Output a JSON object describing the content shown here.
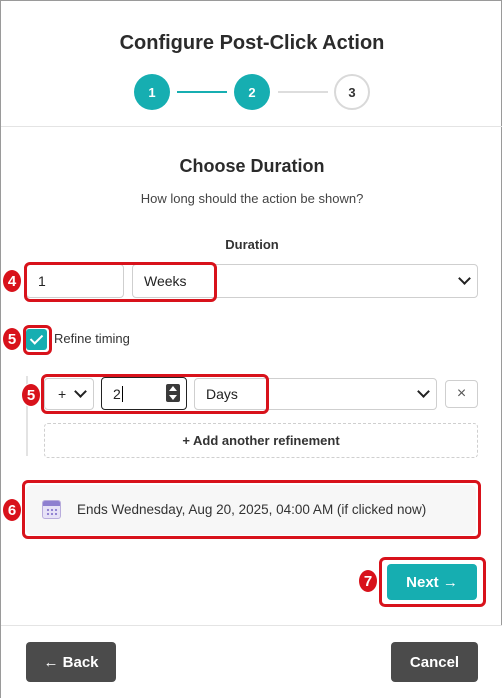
{
  "dialog": {
    "title": "Configure Post-Click Action",
    "steps": [
      {
        "label": "1",
        "state": "active"
      },
      {
        "label": "2",
        "state": "active"
      },
      {
        "label": "3",
        "state": "pending"
      }
    ]
  },
  "section": {
    "title": "Choose Duration",
    "subtitle": "How long should the action be shown?"
  },
  "duration": {
    "label": "Duration",
    "amount_value": "1",
    "unit_selected": "Weeks"
  },
  "refine": {
    "checkbox_label": "Refine timing",
    "checked": true,
    "rows": [
      {
        "operator": "+",
        "amount": "2",
        "unit": "Days",
        "remove_symbol": "×"
      }
    ],
    "add_label": "+ Add another refinement"
  },
  "ends": {
    "icon": "calendar-icon",
    "text": "Ends Wednesday, Aug 20, 2025, 04:00 AM (if clicked now)"
  },
  "actions": {
    "next_label": "Next →",
    "back_label": "← Back",
    "cancel_label": "Cancel"
  },
  "annotations": [
    {
      "number": "4"
    },
    {
      "number": "5"
    },
    {
      "number": "5"
    },
    {
      "number": "6"
    },
    {
      "number": "7"
    }
  ],
  "colors": {
    "accent": "#16aeb1",
    "annotation": "#d8121b",
    "dark_button": "#4b4b4b"
  }
}
